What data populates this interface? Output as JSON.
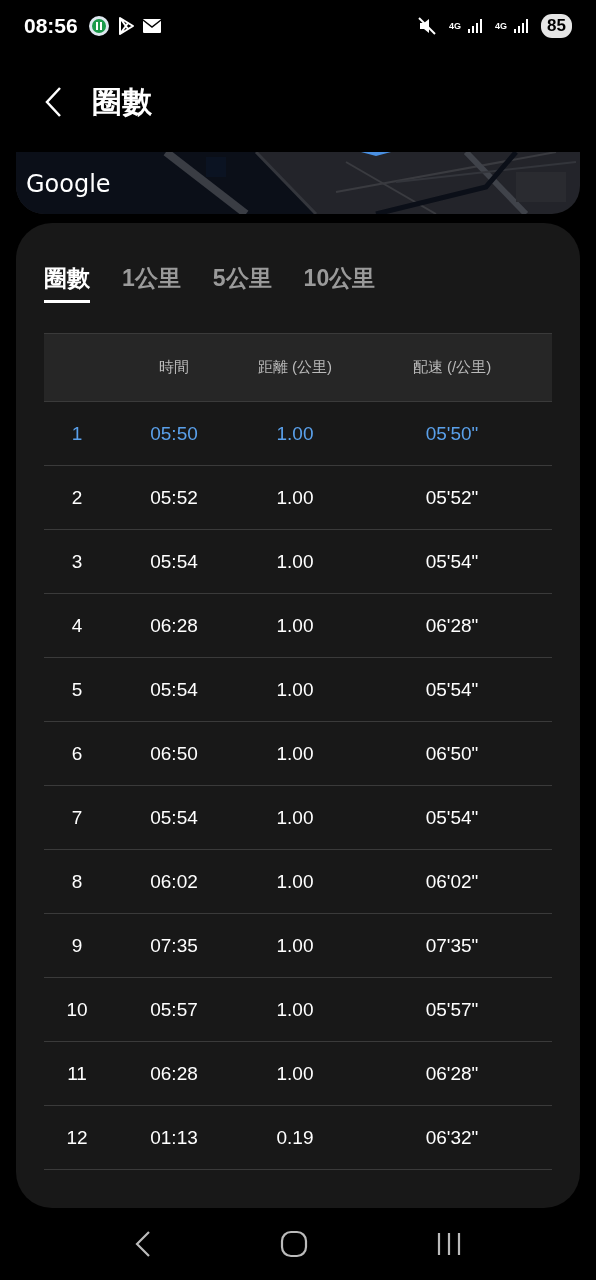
{
  "status_bar": {
    "time": "08:56",
    "network_labels": [
      "4G",
      "4G"
    ],
    "battery": "85"
  },
  "header": {
    "title": "圈數"
  },
  "map": {
    "attribution": "Google"
  },
  "tabs": [
    {
      "label": "圈數",
      "selected": true
    },
    {
      "label": "1公里",
      "selected": false
    },
    {
      "label": "5公里",
      "selected": false
    },
    {
      "label": "10公里",
      "selected": false
    }
  ],
  "table": {
    "columns": [
      "時間",
      "距離 (公里)",
      "配速 (/公里)"
    ],
    "rows": [
      {
        "lap": "1",
        "time": "05:50",
        "distance": "1.00",
        "pace": "05'50\"",
        "selected": true
      },
      {
        "lap": "2",
        "time": "05:52",
        "distance": "1.00",
        "pace": "05'52\"",
        "selected": false
      },
      {
        "lap": "3",
        "time": "05:54",
        "distance": "1.00",
        "pace": "05'54\"",
        "selected": false
      },
      {
        "lap": "4",
        "time": "06:28",
        "distance": "1.00",
        "pace": "06'28\"",
        "selected": false
      },
      {
        "lap": "5",
        "time": "05:54",
        "distance": "1.00",
        "pace": "05'54\"",
        "selected": false
      },
      {
        "lap": "6",
        "time": "06:50",
        "distance": "1.00",
        "pace": "06'50\"",
        "selected": false
      },
      {
        "lap": "7",
        "time": "05:54",
        "distance": "1.00",
        "pace": "05'54\"",
        "selected": false
      },
      {
        "lap": "8",
        "time": "06:02",
        "distance": "1.00",
        "pace": "06'02\"",
        "selected": false
      },
      {
        "lap": "9",
        "time": "07:35",
        "distance": "1.00",
        "pace": "07'35\"",
        "selected": false
      },
      {
        "lap": "10",
        "time": "05:57",
        "distance": "1.00",
        "pace": "05'57\"",
        "selected": false
      },
      {
        "lap": "11",
        "time": "06:28",
        "distance": "1.00",
        "pace": "06'28\"",
        "selected": false
      },
      {
        "lap": "12",
        "time": "01:13",
        "distance": "0.19",
        "pace": "06'32\"",
        "selected": false
      }
    ]
  }
}
